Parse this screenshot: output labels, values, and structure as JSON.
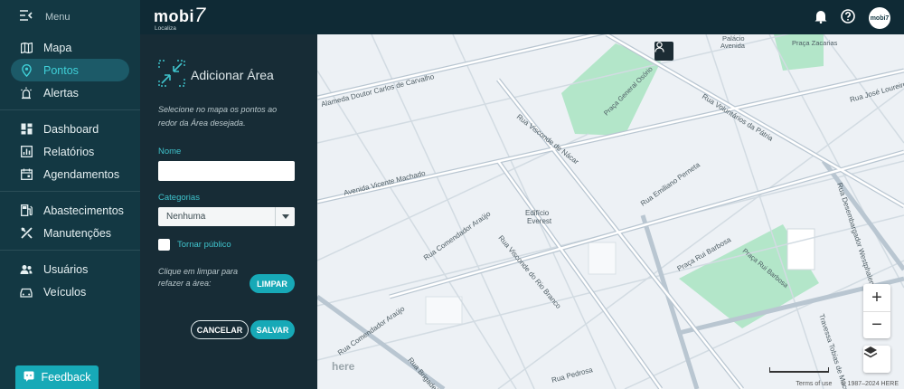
{
  "sidebar": {
    "menu_label": "Menu",
    "groups": [
      [
        {
          "label": "Mapa",
          "icon": "map-icon",
          "active": false
        },
        {
          "label": "Pontos",
          "icon": "location-pin-icon",
          "active": true
        },
        {
          "label": "Alertas",
          "icon": "alert-light-icon",
          "active": false
        }
      ],
      [
        {
          "label": "Dashboard",
          "icon": "dashboard-icon",
          "active": false
        },
        {
          "label": "Relatórios",
          "icon": "report-icon",
          "active": false
        },
        {
          "label": "Agendamentos",
          "icon": "calendar-icon",
          "active": false
        }
      ],
      [
        {
          "label": "Abastecimentos",
          "icon": "fuel-icon",
          "active": false
        },
        {
          "label": "Manutenções",
          "icon": "tools-icon",
          "active": false
        }
      ],
      [
        {
          "label": "Usuários",
          "icon": "users-icon",
          "active": false
        },
        {
          "label": "Veículos",
          "icon": "car-icon",
          "active": false
        }
      ]
    ],
    "feedback_label": "Feedback"
  },
  "header": {
    "logo_text": "mobi",
    "logo_number": "7",
    "logo_sub": "Localiza",
    "avatar_text": "mobi7"
  },
  "panel": {
    "title": "Adicionar Área",
    "description": "Selecione no mapa os pontos ao redor da Área desejada.",
    "name_label": "Nome",
    "name_value": "",
    "category_label": "Categorias",
    "category_value": "Nenhuma",
    "public_label": "Tornar público",
    "clear_hint": "Clique em limpar para refazer a área:",
    "clear_button": "LIMPAR",
    "cancel_button": "CANCELAR",
    "save_button": "SALVAR"
  },
  "map": {
    "labels": {
      "l1": "Alameda Doutor Carlos de Carvalho",
      "l2": "Avenida Vicente Machado",
      "l3": "Rua Visconde de Nácar",
      "l4": "Rua Comendador Araújo",
      "l5": "Rua Visconde do Rio Branco",
      "l6": "Edifício",
      "l7": "Everest",
      "l8": "Praça General Osório",
      "l9": "Rua Voluntários da Pátria",
      "l10": "Rua Emiliano Perneta",
      "l11": "Praça Rui Barbosa",
      "l12": "Rua Desembargador Westphalen",
      "l13": "Rua José Loureiro",
      "l14": "Praça Zacarias",
      "l15": "Palácio",
      "l16": "Avenida",
      "l17": "Praça Rui Barbosa",
      "l18": "Travessa Tobias de Macedo",
      "l19": "Rua Brigadeiro",
      "l20": "Rua Pedrosa",
      "l21": "Rua Comendador Araújo"
    },
    "here_logo": "here",
    "attribution_terms": "Terms of use",
    "attribution_copy": "© 1987–2024 HERE"
  }
}
